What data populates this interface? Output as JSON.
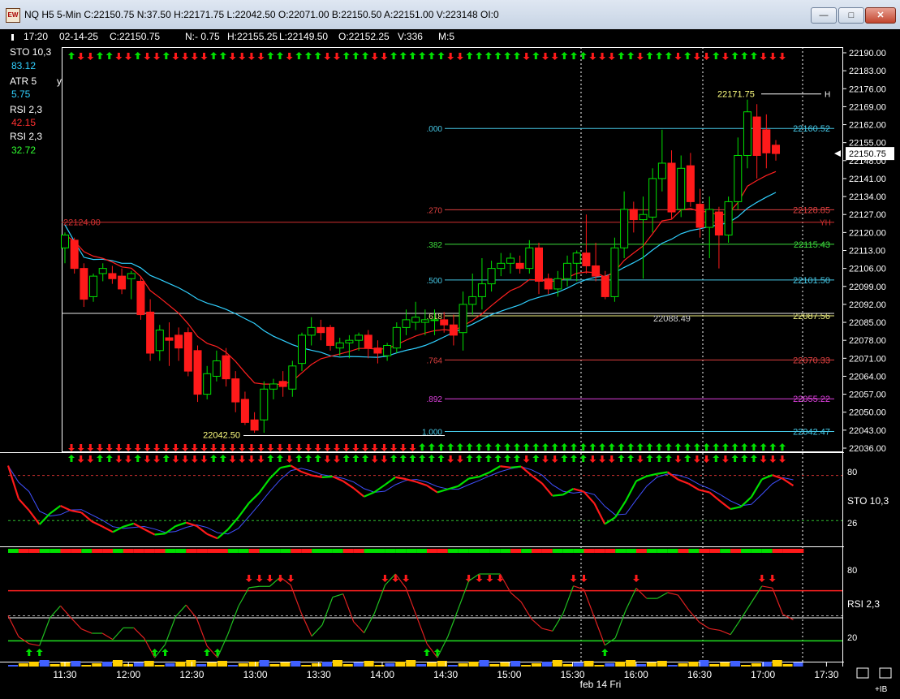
{
  "window": {
    "title": "NQ H5 5-Min C:22150.75 N:37.50 H:22171.75 L:22042.50 O:22071.00 B:22150.50 A:22151.00 V:223148 OI:0",
    "icon": "app-icon",
    "min_icon": "minimize-icon",
    "max_icon": "maximize-icon",
    "close_icon": "close-icon"
  },
  "colors": {
    "up": "#00e000",
    "down": "#ff1a1a",
    "sma": "#30d0ff",
    "ema": "#ff2020",
    "axis": "#ffffff",
    "fib_cyan": "#46c8e6",
    "fib_red": "#e04040",
    "fib_green": "#3cdc3c",
    "fib_mag": "#e040e0",
    "fib_yellow": "#f0f080"
  },
  "header_bar": {
    "time": "17:20",
    "date": "02-14-25",
    "close": "C:22150.75",
    "net": "N:- 0.75",
    "high": "H:22155.25",
    "low": "L:22149.50",
    "open": "O:22152.25",
    "volume": "V:336",
    "bar_size": "M:5"
  },
  "left_legend": {
    "sto_label": "STO  10,3",
    "sto_value": "83.12",
    "atr_label": "ATR  5",
    "atr_value": "5.75",
    "atr_y": "y",
    "rsi1_label": "RSI  2,3",
    "rsi1_value": "42.15",
    "rsi2_label": "RSI  2,3",
    "rsi2_value": "32.72"
  },
  "chart_data": [
    {
      "type": "candlestick",
      "title": "NQ H5 5-Min",
      "ylim": [
        22033,
        22193
      ],
      "y_ticks": [
        "22190.00",
        "22183.00",
        "22176.00",
        "22169.00",
        "22162.00",
        "22155.00",
        "22148.00",
        "22141.00",
        "22134.00",
        "22127.00",
        "22120.00",
        "22113.00",
        "22106.00",
        "22099.00",
        "22092.00",
        "22085.00",
        "22078.00",
        "22071.00",
        "22064.00",
        "22057.00",
        "22050.00",
        "22043.00",
        "22036.00"
      ],
      "current_price": "22150.75",
      "x_ticks": [
        "11:30",
        "12:00",
        "12:30",
        "13:00",
        "13:30",
        "14:00",
        "14:30",
        "15:00",
        "15:30",
        "16:00",
        "16:30",
        "17:00",
        "17:30"
      ],
      "x_caption": "feb 14 Fri",
      "ohlc": [
        [
          22114,
          22120,
          22108,
          22119
        ],
        [
          22117,
          22118,
          22104,
          22106
        ],
        [
          22106,
          22108,
          22091,
          22094
        ],
        [
          22095,
          22104,
          22093,
          22103
        ],
        [
          22104,
          22108,
          22101,
          22106
        ],
        [
          22104,
          22107,
          22100,
          22102
        ],
        [
          22103,
          22106,
          22096,
          22098
        ],
        [
          22102,
          22105,
          22094,
          22104
        ],
        [
          22101,
          22103,
          22086,
          22088
        ],
        [
          22089,
          22094,
          22070,
          22073
        ],
        [
          22074,
          22084,
          22070,
          22082
        ],
        [
          22079,
          22085,
          22068,
          22078
        ],
        [
          22080,
          22083,
          22070,
          22075
        ],
        [
          22081,
          22083,
          22064,
          22066
        ],
        [
          22074,
          22076,
          22054,
          22057
        ],
        [
          22057,
          22068,
          22055,
          22065
        ],
        [
          22064,
          22074,
          22062,
          22070
        ],
        [
          22072,
          22075,
          22060,
          22063
        ],
        [
          22063,
          22066,
          22050,
          22054
        ],
        [
          22055,
          22058,
          22045,
          22046
        ],
        [
          22047,
          22050,
          22042,
          22043
        ],
        [
          22047,
          22062,
          22042,
          22059
        ],
        [
          22059,
          22063,
          22055,
          22061
        ],
        [
          22062,
          22066,
          22056,
          22060
        ],
        [
          22059,
          22070,
          22056,
          22068
        ],
        [
          22069,
          22081,
          22066,
          22080
        ],
        [
          22080,
          22087,
          22076,
          22083
        ],
        [
          22083,
          22086,
          22078,
          22081
        ],
        [
          22083,
          22084,
          22074,
          22076
        ],
        [
          22075,
          22079,
          22072,
          22077
        ],
        [
          22077,
          22080,
          22071,
          22078
        ],
        [
          22078,
          22081,
          22074,
          22080
        ],
        [
          22080,
          22082,
          22071,
          22075
        ],
        [
          22075,
          22078,
          22069,
          22073
        ],
        [
          22072,
          22077,
          22070,
          22076
        ],
        [
          22075,
          22085,
          22073,
          22083
        ],
        [
          22083,
          22090,
          22080,
          22086
        ],
        [
          22085,
          22093,
          22082,
          22087
        ],
        [
          22085,
          22090,
          22080,
          22086
        ],
        [
          22086,
          22090,
          22080,
          22086
        ],
        [
          22086,
          22089,
          22081,
          22084
        ],
        [
          22084,
          22088,
          22076,
          22080
        ],
        [
          22081,
          22097,
          22074,
          22092
        ],
        [
          22092,
          22104,
          22088,
          22095
        ],
        [
          22095,
          22110,
          22090,
          22100
        ],
        [
          22100,
          22109,
          22097,
          22106
        ],
        [
          22106,
          22112,
          22103,
          22108
        ],
        [
          22108,
          22112,
          22104,
          22110
        ],
        [
          22108,
          22111,
          22104,
          22106
        ],
        [
          22106,
          22117,
          22104,
          22114
        ],
        [
          22114,
          22116,
          22096,
          22101
        ],
        [
          22102,
          22104,
          22096,
          22098
        ],
        [
          22098,
          22105,
          22095,
          22102
        ],
        [
          22102,
          22111,
          22099,
          22108
        ],
        [
          22108,
          22113,
          22101,
          22112
        ],
        [
          22112,
          22127,
          22104,
          22107
        ],
        [
          22107,
          22116,
          22101,
          22103
        ],
        [
          22103,
          22105,
          22094,
          22095
        ],
        [
          22095,
          22118,
          22093,
          22114
        ],
        [
          22114,
          22136,
          22110,
          22129
        ],
        [
          22129,
          22132,
          22120,
          22125
        ],
        [
          22125,
          22134,
          22102,
          22127
        ],
        [
          22126,
          22145,
          22120,
          22141
        ],
        [
          22141,
          22160,
          22136,
          22147
        ],
        [
          22147,
          22152,
          22125,
          22128
        ],
        [
          22129,
          22150,
          22126,
          22145
        ],
        [
          22146,
          22151,
          22130,
          22132
        ],
        [
          22131,
          22137,
          22118,
          22122
        ],
        [
          22122,
          22134,
          22110,
          22129
        ],
        [
          22128,
          22130,
          22106,
          22119
        ],
        [
          22119,
          22134,
          22116,
          22132
        ],
        [
          22132,
          22157,
          22129,
          22150
        ],
        [
          22150,
          22171.75,
          22145,
          22167
        ],
        [
          22165,
          22170,
          22141,
          22150
        ],
        [
          22160,
          22166,
          22145,
          22151
        ],
        [
          22154,
          22156,
          22148,
          22150.75
        ]
      ],
      "fib_levels": [
        {
          "ratio": ".000",
          "price": "22160.52",
          "color": "#46c8e6"
        },
        {
          "ratio": ".270",
          "price": "22128.85",
          "color": "#e04040"
        },
        {
          "ratio": ".382",
          "price": "22115.43",
          "color": "#3cdc3c"
        },
        {
          "ratio": ".500",
          "price": "22101.50",
          "color": "#46c8e6"
        },
        {
          "ratio": ".618",
          "price": "22087.56",
          "color": "#f0f080"
        },
        {
          "ratio": ".764",
          "price": "22070.33",
          "color": "#e04040"
        },
        {
          "ratio": ".892",
          "price": "22055.22",
          "color": "#e040e0"
        },
        {
          "ratio": "1.000",
          "price": "22042.47",
          "color": "#46c8e6"
        }
      ],
      "annotations": {
        "high": "22171.75",
        "high_tag": "H",
        "low": "22042.50",
        "level_left": "22124.00",
        "level_tag": "YH",
        "mid_level": "22088.49"
      }
    },
    {
      "type": "line",
      "name": "STO  10,3",
      "ylim": [
        0,
        100
      ],
      "levels": [
        "80",
        "26"
      ],
      "label": "STO  10,3"
    },
    {
      "type": "line",
      "name": "RSI  2,3",
      "ylim": [
        0,
        100
      ],
      "levels": [
        "80",
        "20"
      ],
      "label": "RSI  2,3"
    }
  ],
  "bottom_right": {
    "ib_label": "+IB"
  }
}
